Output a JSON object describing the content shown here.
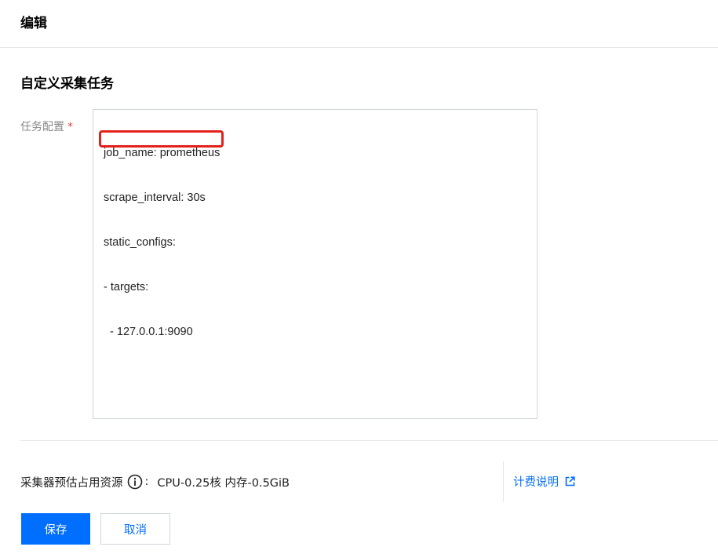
{
  "header": {
    "title": "编辑"
  },
  "section": {
    "title": "自定义采集任务"
  },
  "task_config": {
    "label": "任务配置",
    "required_mark": "*",
    "lines": [
      "job_name: prometheus",
      "scrape_interval: 30s",
      "static_configs:",
      "- targets:",
      "  - 127.0.0.1:9090"
    ],
    "highlighted_line": "scrape_interval: 30s"
  },
  "resource": {
    "label": "采集器预估占用资源",
    "colon": ":",
    "value": "CPU-0.25核 内存-0.5GiB"
  },
  "billing": {
    "label": "计费说明"
  },
  "buttons": {
    "save": "保存",
    "cancel": "取消"
  },
  "colors": {
    "primary": "#006eff",
    "highlight": "#e3221b",
    "required": "#e54545",
    "border": "#cfd5de"
  },
  "icons": {
    "info": "info-icon",
    "external": "external-link-icon"
  }
}
